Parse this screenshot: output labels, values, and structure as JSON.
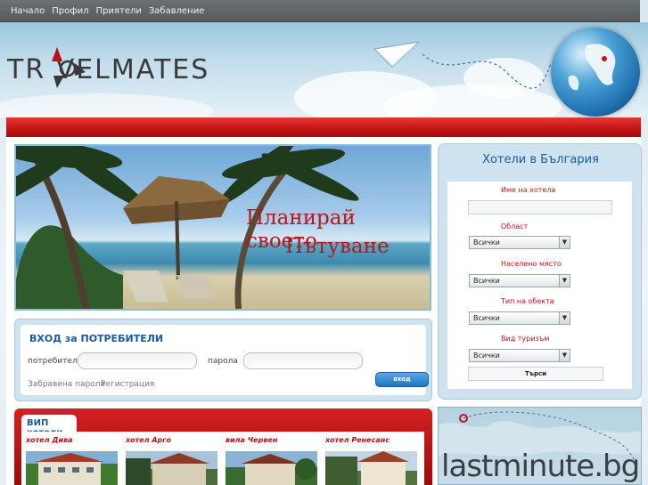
{
  "nav": {
    "items": [
      "Начало",
      "Профил",
      "Приятели",
      "Забавление"
    ]
  },
  "header": {
    "logo_text": "TR VELMATES"
  },
  "banner": {
    "line1": "Планирай своето",
    "line2": "Пътуване"
  },
  "login": {
    "title": "ВХОД за ПОТРЕБИТЕЛИ",
    "user_label": "потребител",
    "pass_label": "парола",
    "forgot": "Забравена парола",
    "register": "Регистрация",
    "button": "вход"
  },
  "vip": {
    "tab": "ВИП хотели",
    "hotels": [
      {
        "name": "хотел Дива"
      },
      {
        "name": "хотел Арго"
      },
      {
        "name": "вила Червен"
      },
      {
        "name": "хотел Ренесанс"
      }
    ]
  },
  "search": {
    "title": "Хотели в България",
    "name_label": "Име на хотела",
    "region_label": "Област",
    "region_value": "Всички",
    "place_label": "Населено място",
    "place_value": "Всички",
    "type_label": "Тип на обекта",
    "type_value": "Всички",
    "tourism_label": "Вид туризъм",
    "tourism_value": "Всички",
    "button": "Търси"
  },
  "ad": {
    "text": "lastminute.bg"
  },
  "colors": {
    "brand_red": "#c71414",
    "link_blue": "#1a5a9c"
  }
}
